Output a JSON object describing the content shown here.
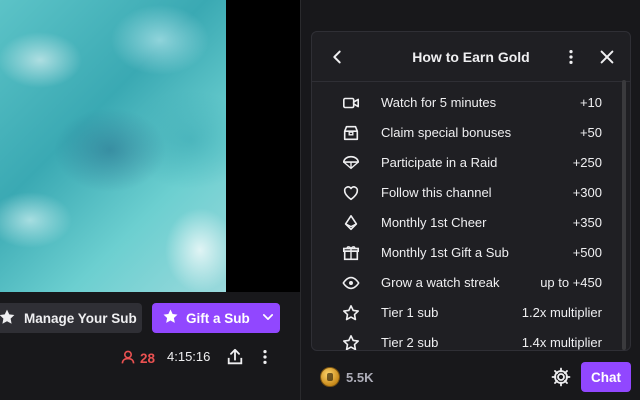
{
  "channel": {
    "manage_sub_label": "Manage Your Sub",
    "gift_sub_label": "Gift a Sub",
    "viewer_count": "28",
    "uptime": "4:15:16"
  },
  "popover": {
    "title": "How to Earn Gold",
    "rows": [
      {
        "icon": "video-camera-icon",
        "label": "Watch for 5 minutes",
        "value": "+10"
      },
      {
        "icon": "treasure-chest-icon",
        "label": "Claim special bonuses",
        "value": "+50"
      },
      {
        "icon": "parachute-icon",
        "label": "Participate in a Raid",
        "value": "+250"
      },
      {
        "icon": "heart-icon",
        "label": "Follow this channel",
        "value": "+300"
      },
      {
        "icon": "bits-icon",
        "label": "Monthly 1st Cheer",
        "value": "+350"
      },
      {
        "icon": "gift-icon",
        "label": "Monthly 1st Gift a Sub",
        "value": "+500"
      },
      {
        "icon": "eye-icon",
        "label": "Grow a watch streak",
        "value": "up to +450"
      },
      {
        "icon": "star-icon",
        "label": "Tier 1 sub",
        "value": "1.2x multiplier"
      },
      {
        "icon": "star-icon",
        "label": "Tier 2 sub",
        "value": "1.4x multiplier"
      }
    ]
  },
  "chat_footer": {
    "gold_amount": "5.5K",
    "chat_label": "Chat"
  },
  "colors": {
    "accent": "#9147ff",
    "live_red": "#eb5151",
    "panel": "#1f1f23",
    "background": "#18181b"
  }
}
